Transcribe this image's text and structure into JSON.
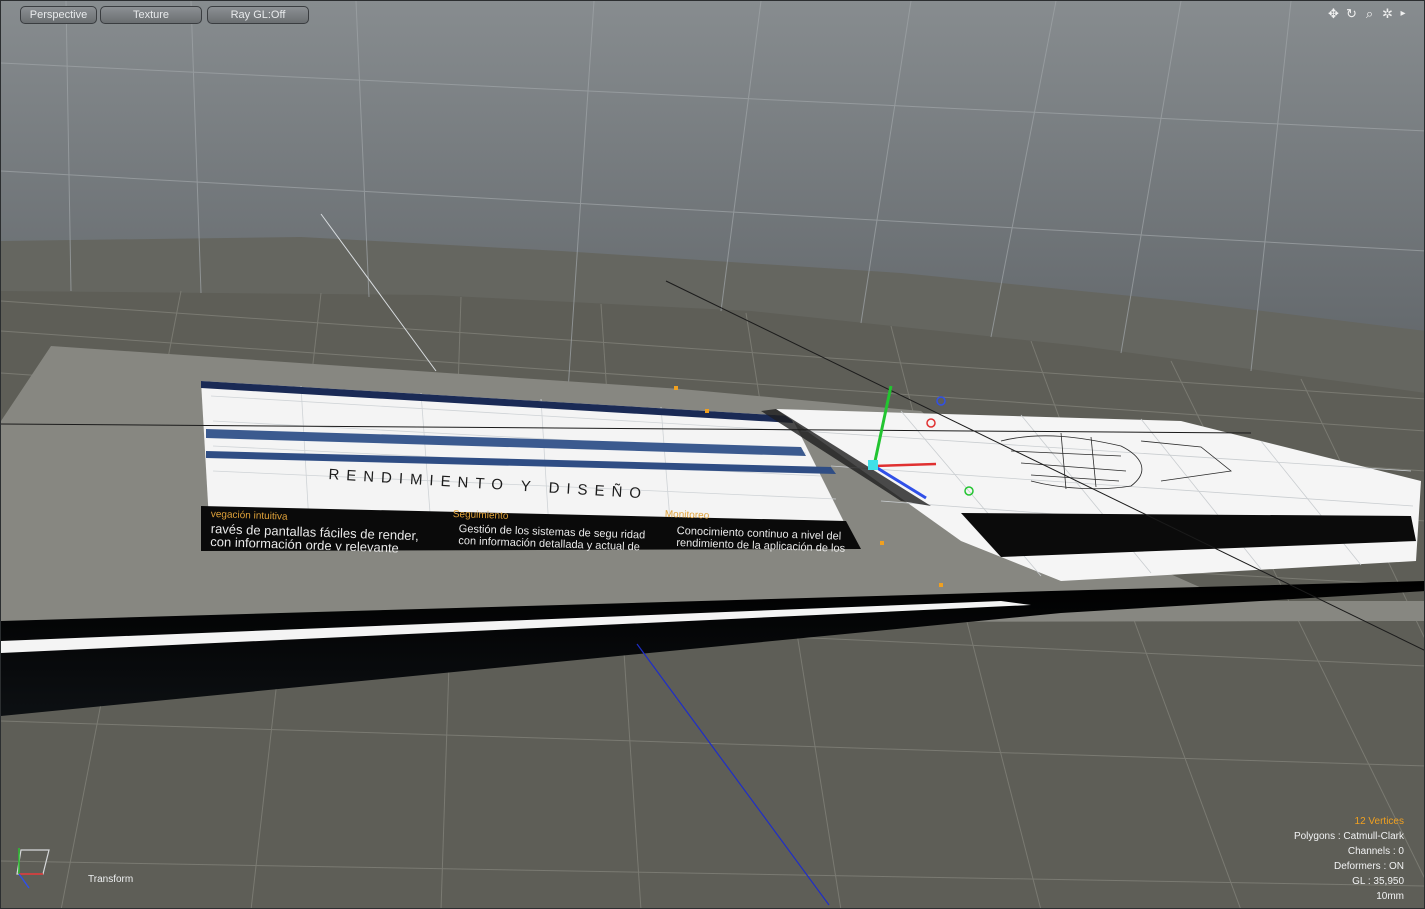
{
  "viewport": {
    "buttons": [
      {
        "label": "Perspective"
      },
      {
        "label": "Texture"
      },
      {
        "label": "Ray GL:Off"
      }
    ],
    "icons": [
      "move-view-icon",
      "rotate-view-icon",
      "zoom-view-icon",
      "settings-icon",
      "expand-arrow-icon"
    ],
    "tool_label": "Transform"
  },
  "page_content": {
    "heading": "RENDIMIENTO Y DISEÑO",
    "sections": [
      {
        "title": "vegación intuitiva",
        "body": "ravés de pantallas fáciles de render, con información orde y relevante"
      },
      {
        "title": "Seguimiento",
        "body": "Gestión de los sistemas de segu ridad con información detallada y actual de todos los sistemas"
      },
      {
        "title": "Monitoreo",
        "body": "Conocimiento continuo a nivel del rendimiento de la aplicación de los sistemas de seguridad"
      }
    ]
  },
  "stats": {
    "selection": "12 Vertices",
    "polygons": "Polygons : Catmull-Clark",
    "channels": "Channels : 0",
    "deformers": "Deformers : ON",
    "gl": "GL : 35,950",
    "unit": "10mm"
  },
  "colors": {
    "sky_top": "#82878a",
    "sky_bottom": "#43484c",
    "floor": "#5e5e57",
    "selection": "#f0a020"
  }
}
